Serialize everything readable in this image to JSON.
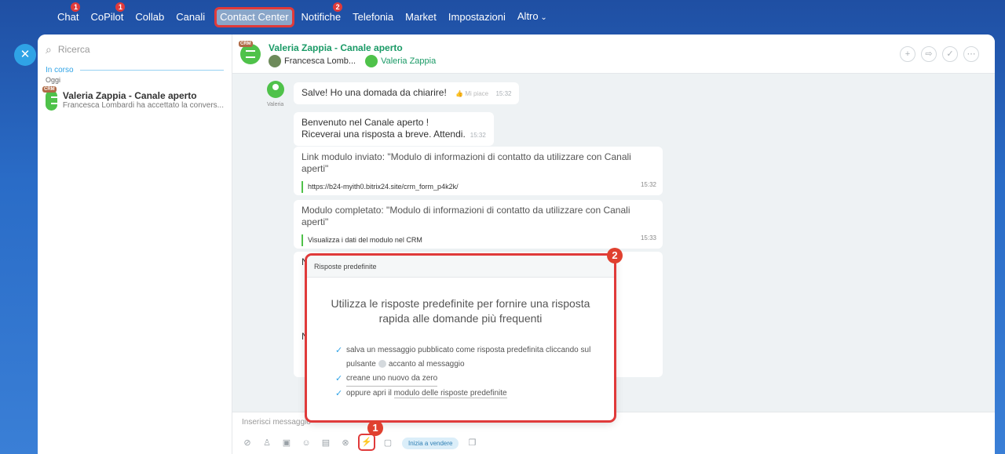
{
  "nav": {
    "items": [
      {
        "label": "Chat",
        "badge": "1"
      },
      {
        "label": "CoPilot",
        "badge": "1"
      },
      {
        "label": "Collab",
        "badge": ""
      },
      {
        "label": "Canali",
        "badge": ""
      },
      {
        "label": "Contact Center",
        "badge": ""
      },
      {
        "label": "Notifiche",
        "badge": "2"
      },
      {
        "label": "Telefonia",
        "badge": ""
      },
      {
        "label": "Market",
        "badge": ""
      },
      {
        "label": "Impostazioni",
        "badge": ""
      },
      {
        "label": "Altro",
        "badge": ""
      }
    ]
  },
  "sidebar": {
    "search_placeholder": "Ricerca",
    "section": "In corso",
    "sub": "Oggi",
    "conversation": {
      "badge": "CRM",
      "title": "Valeria Zappia - Canale aperto",
      "subtitle": "Francesca Lombardi ha accettato la convers..."
    }
  },
  "chat": {
    "header": {
      "badge": "CRM",
      "title": "Valeria Zappia - Canale aperto",
      "person1": "Francesca Lomb...",
      "person2": "Valeria Zappia"
    },
    "user_name": "Valeria",
    "messages": {
      "m1": {
        "text": "Salve! Ho una domada da chiarire!",
        "like": "Mi piace",
        "time": "15:32"
      },
      "m2": {
        "line1": "Benvenuto nel Canale aperto !",
        "line2": "Riceverai una risposta a breve. Attendi.",
        "time": "15:32"
      },
      "m3": {
        "title": "Link modulo inviato: \"Modulo di informazioni di contatto da utilizzare con Canali aperti\"",
        "link": "https://b24-myith0.bitrix24.site/crm_form_p4k2k/",
        "time": "15:32"
      },
      "m4": {
        "title": "Modulo completato: \"Modulo di informazioni di contatto da utilizzare con Canali aperti\"",
        "link": "Visualizza i dati del modulo nel CRM",
        "time": "15:33"
      },
      "m5": {
        "partial1": "N",
        "partial2": "N"
      }
    },
    "composer": {
      "placeholder": "Inserisci messaggio",
      "sell_label": "Inizia a vendere"
    }
  },
  "popup": {
    "header": "Risposte predefinite",
    "title": "Utilizza le risposte predefinite per fornire una risposta rapida alle domande più frequenti",
    "item1a": "salva un messaggio pubblicato come risposta predefinita cliccando sul",
    "item1b": "pulsante",
    "item1c": "accanto al messaggio",
    "item2": "creane uno nuovo da zero",
    "item3a": "oppure apri il",
    "item3b": "modulo delle risposte predefinite"
  },
  "steps": {
    "one": "1",
    "two": "2"
  },
  "colors": {
    "accent": "#2fa3e6",
    "highlight": "#e03a3a",
    "online_green": "#4fc24a"
  }
}
